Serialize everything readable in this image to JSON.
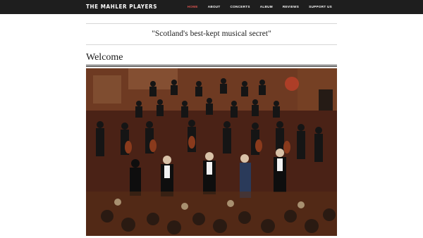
{
  "header": {
    "brand": "THE MAHLER PLAYERS",
    "nav": [
      {
        "label": "HOME",
        "active": true
      },
      {
        "label": "ABOUT",
        "active": false
      },
      {
        "label": "CONCERTS",
        "active": false
      },
      {
        "label": "ALBUM",
        "active": false
      },
      {
        "label": "REVIEWS",
        "active": false
      },
      {
        "label": "SUPPORT US",
        "active": false
      }
    ]
  },
  "main": {
    "tagline": "\"Scotland's best-kept musical secret\"",
    "heading": "Welcome",
    "photo_icon": "orchestra-photo"
  },
  "colors": {
    "topbar": "#1e1e1e",
    "active_nav": "#d9534f"
  }
}
